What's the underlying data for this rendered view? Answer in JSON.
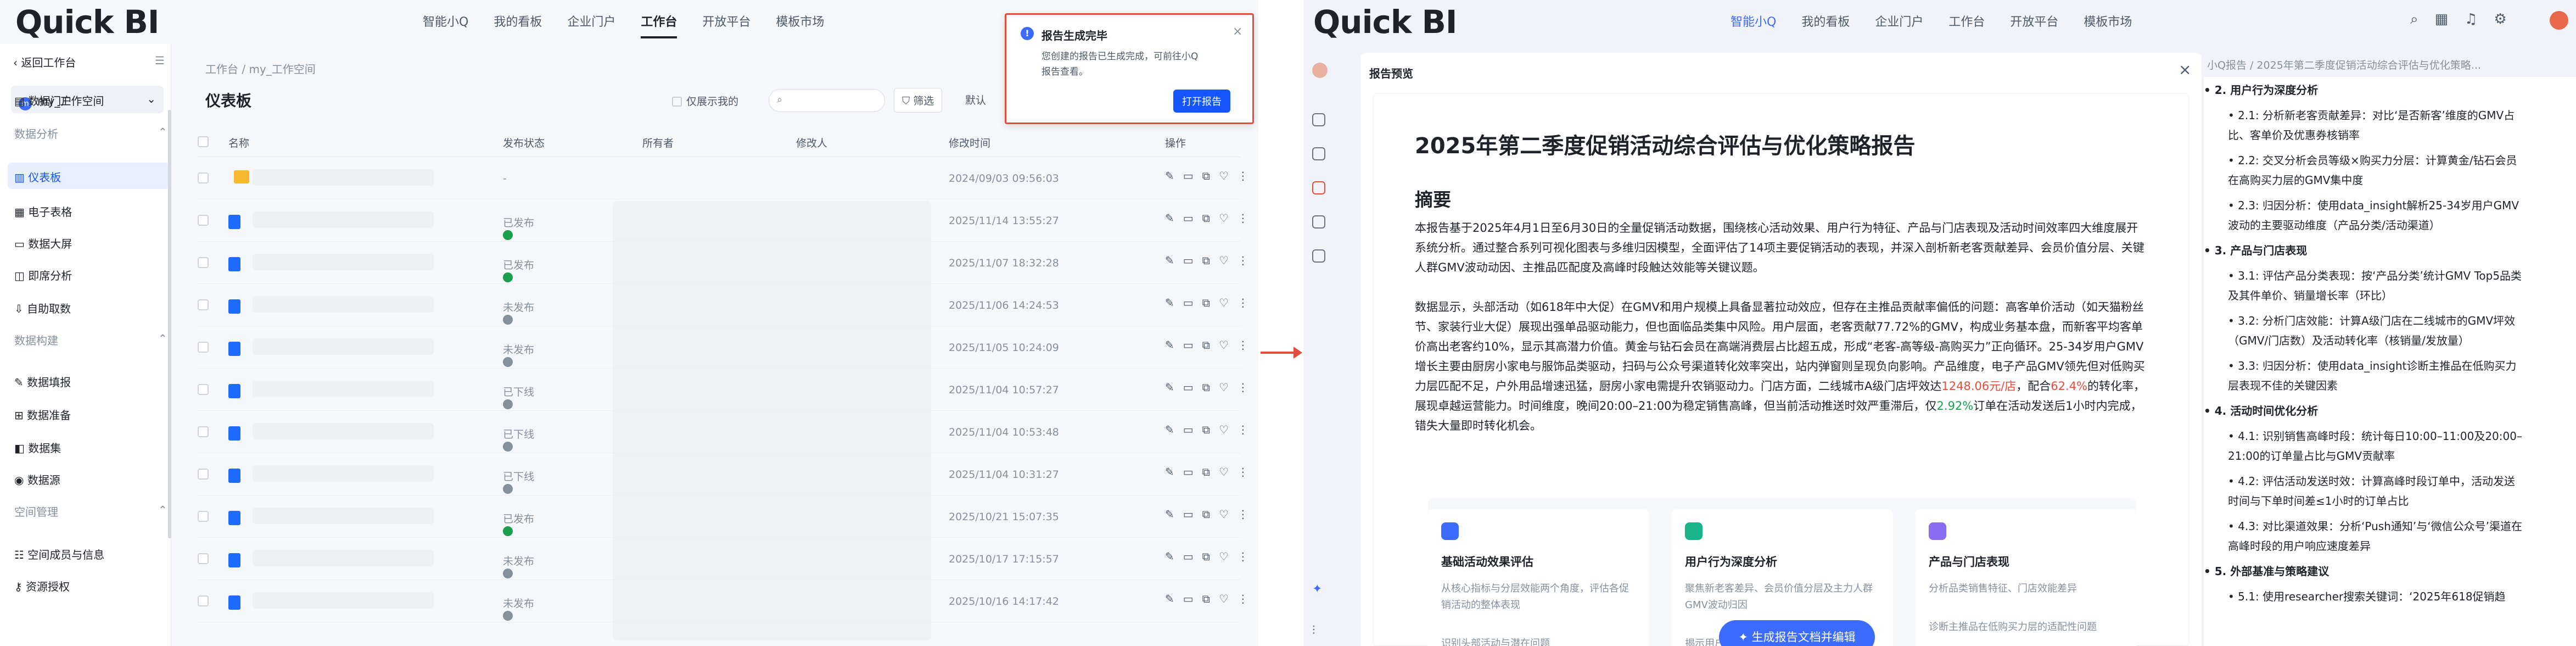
{
  "left": {
    "brand": "Quick BI",
    "nav": [
      "智能小Q",
      "我的看板",
      "企业门户",
      "工作台",
      "开放平台",
      "模板市场"
    ],
    "nav_active": "工作台",
    "sidebar": {
      "back": "返回工作台",
      "workspace": "my_工作空间",
      "items": [
        {
          "label": "数据门户",
          "type": "item"
        },
        {
          "label": "数据分析",
          "type": "group"
        },
        {
          "label": "仪表板",
          "type": "active"
        },
        {
          "label": "电子表格",
          "type": "item"
        },
        {
          "label": "数据大屏",
          "type": "item"
        },
        {
          "label": "即席分析",
          "type": "item"
        },
        {
          "label": "自助取数",
          "type": "item"
        },
        {
          "label": "数据构建",
          "type": "group"
        },
        {
          "label": "数据填报",
          "type": "item"
        },
        {
          "label": "数据准备",
          "type": "item"
        },
        {
          "label": "数据集",
          "type": "item"
        },
        {
          "label": "数据源",
          "type": "item"
        },
        {
          "label": "空间管理",
          "type": "group"
        },
        {
          "label": "空间成员与信息",
          "type": "item"
        },
        {
          "label": "资源授权",
          "type": "item"
        }
      ]
    },
    "breadcrumb": [
      "工作台",
      "my_工作空间"
    ],
    "page_title": "仪表板",
    "toolbar": {
      "only_mine": "仅展示我的",
      "filter": "筛选",
      "default": "默认"
    },
    "columns": [
      "名称",
      "发布状态",
      "所有者",
      "修改人",
      "修改时间",
      "操作"
    ],
    "rows": [
      {
        "status": "-",
        "status_color": "",
        "time": "2024/09/03 09:56:03",
        "folder": true
      },
      {
        "status": "已发布",
        "status_color": "#1a9f4b",
        "time": "2025/11/14 13:55:27"
      },
      {
        "status": "已发布",
        "status_color": "#1a9f4b",
        "time": "2025/11/07 18:32:28"
      },
      {
        "status": "未发布",
        "status_color": "#86909c",
        "time": "2025/11/06 14:24:53"
      },
      {
        "status": "未发布",
        "status_color": "#86909c",
        "time": "2025/11/05 10:24:09"
      },
      {
        "status": "已下线",
        "status_color": "#86909c",
        "time": "2025/11/04 10:57:27"
      },
      {
        "status": "已下线",
        "status_color": "#86909c",
        "time": "2025/11/04 10:53:48"
      },
      {
        "status": "已下线",
        "status_color": "#86909c",
        "time": "2025/11/04 10:31:27"
      },
      {
        "status": "已发布",
        "status_color": "#1a9f4b",
        "time": "2025/10/21 15:07:35"
      },
      {
        "status": "未发布",
        "status_color": "#86909c",
        "time": "2025/10/17 17:15:57"
      },
      {
        "status": "未发布",
        "status_color": "#86909c",
        "time": "2025/10/16 14:17:42"
      }
    ],
    "toast": {
      "title": "报告生成完毕",
      "body": "您创建的报告已生成完成，可前往小Q报告查看。",
      "button": "打开报告"
    }
  },
  "right": {
    "brand": "Quick BI",
    "nav": [
      "智能小Q",
      "我的看板",
      "企业门户",
      "工作台",
      "开放平台",
      "模板市场"
    ],
    "nav_active": "智能小Q",
    "modal_title": "报告预览",
    "report": {
      "title": "2025年第二季度促销活动综合评估与优化策略报告",
      "summary_heading": "摘要",
      "p1": "本报告基于2025年4月1日至6月30日的全量促销活动数据，围绕核心活动效果、用户行为特征、产品与门店表现及活动时间效率四大维度展开系统分析。通过整合系列可视化图表与多维归因模型，全面评估了14项主要促销活动的表现，并深入剖析新老客贡献差异、会员价值分层、关键人群GMV波动动因、主推品匹配度及高峰时段触达效能等关键议题。",
      "p2a": "数据显示，头部活动（如618年中大促）在GMV和用户规模上具备显著拉动效应，但存在主推品贡献率偏低的问题：高客单价活动（如天猫粉丝节、家装行业大促）展现出强单品驱动能力，但也面临品类集中风险。用户层面，老客贡献77.72%的GMV，构成业务基本盘，而新客平均客单价高出老客约10%，显示其高潜力价值。黄金与钻石会员在高端消费层占比超五成，形成“老客-高等级-高购买力”正向循环。25-34岁用户GMV增长主要由厨房小家电与服饰品类驱动，扫码与公众号渠道转化效率突出，站内弹窗则呈现负向影响。产品维度，电子产品GMV领先但对低购买力层匹配不足，户外用品增速迅猛，厨房小家电需提升农销驱动力。门店方面，二线城市A级门店坪效达",
      "p2_red1": "1248.06元/店",
      "p2b": "，配合",
      "p2_red2": "62.4%",
      "p2c": "的转化率，展现卓越运营能力。时间维度，晚间20:00–21:00为稳定销售高峰，但当前活动推送时效严重滞后，仅",
      "p2_grn": "2.92%",
      "p2d": "订单在活动发送后1小时内完成，错失大量即时转化机会。",
      "cards": [
        {
          "title": "基础活动效果评估",
          "desc": "从核心指标与分层效能两个角度，评估各促销活动的整体表现",
          "link": "识别头部活动与潜在问题",
          "color": "#3b6cff"
        },
        {
          "title": "用户行为深度分析",
          "desc": "聚焦新老客差异、会员价值分层及主力人群GMV波动归因",
          "link": "揭示用户结构",
          "color": "#19b38c"
        },
        {
          "title": "产品与门店表现",
          "desc": "分析品类销售特征、门店效能差异",
          "link": "诊断主推品在低购买力层的适配性问题",
          "color": "#8a6cf2"
        }
      ],
      "generate_button": "生成报告文档并编辑"
    },
    "outline": {
      "breadcrumb": "小Q报告 / 2025年第二季度促销活动综合评估与优化策略...",
      "lines": [
        {
          "text": "2. 用户行为深度分析",
          "kind": "sec"
        },
        {
          "text": "2.1: 分析新老客贡献差异：对比‘是否新客’维度的GMV占比、客单价及优惠券核销率",
          "kind": "sub"
        },
        {
          "text": "2.2: 交叉分析会员等级×购买力分层：计算黄金/钻石会员在高购买力层的GMV集中度",
          "kind": "sub"
        },
        {
          "text": "2.3: 归因分析：使用data_insight解析25-34岁用户GMV波动的主要驱动维度（产品分类/活动渠道）",
          "kind": "sub"
        },
        {
          "text": "3. 产品与门店表现",
          "kind": "sec"
        },
        {
          "text": "3.1: 评估产品分类表现：按‘产品分类’统计GMV Top5品类及其件单价、销量增长率（环比）",
          "kind": "sub"
        },
        {
          "text": "3.2: 分析门店效能：计算A级门店在二线城市的GMV坪效（GMV/门店数）及活动转化率（核销量/发放量）",
          "kind": "sub"
        },
        {
          "text": "3.3: 归因分析：使用data_insight诊断主推品在低购买力层表现不佳的关键因素",
          "kind": "sub"
        },
        {
          "text": "4. 活动时间优化分析",
          "kind": "sec"
        },
        {
          "text": "4.1: 识别销售高峰时段：统计每日10:00–11:00及20:00–21:00的订单量占比与GMV贡献率",
          "kind": "sub"
        },
        {
          "text": "4.2: 评估活动发送时效：计算高峰时段订单中，活动发送时间与下单时间差≤1小时的订单占比",
          "kind": "sub"
        },
        {
          "text": "4.3: 对比渠道效果：分析‘Push通知’与‘微信公众号’渠道在高峰时段的用户响应速度差异",
          "kind": "sub"
        },
        {
          "text": "5. 外部基准与策略建议",
          "kind": "sec"
        },
        {
          "text": "5.1: 使用researcher搜索关键词：‘2025年618促销趋",
          "kind": "sub"
        }
      ]
    }
  }
}
